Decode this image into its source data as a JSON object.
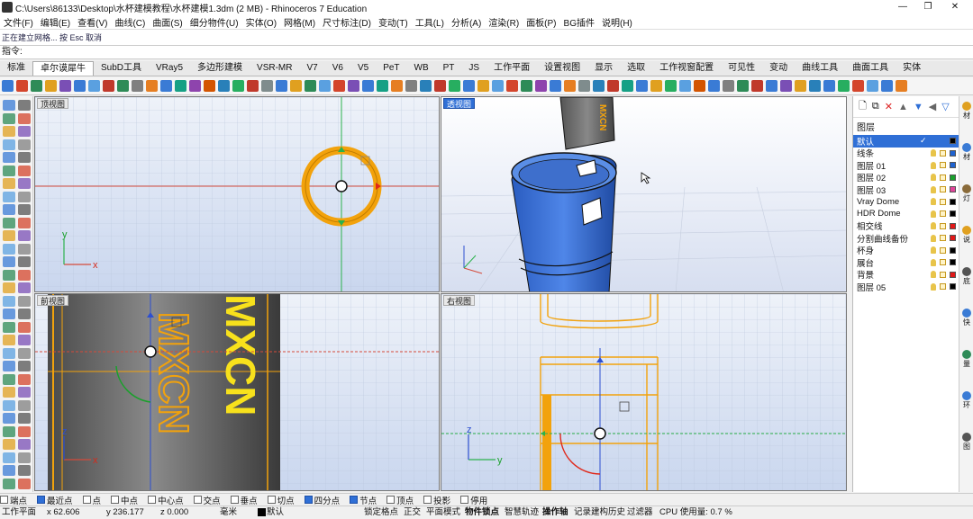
{
  "window": {
    "title": "C:\\Users\\86133\\Desktop\\水杯建模教程\\水杯建模1.3dm (2 MB) - Rhinoceros 7 Education",
    "controls": [
      "—",
      "❐",
      "✕"
    ]
  },
  "menu": [
    "文件(F)",
    "编辑(E)",
    "查看(V)",
    "曲线(C)",
    "曲面(S)",
    "细分物件(U)",
    "实体(O)",
    "网格(M)",
    "尺寸标注(D)",
    "变动(T)",
    "工具(L)",
    "分析(A)",
    "渲染(R)",
    "面板(P)",
    "BG插件",
    "说明(H)"
  ],
  "command": {
    "history": "正在建立网格... 按 Esc 取消",
    "prompt": "指令:"
  },
  "tabs": [
    "标准",
    "卓尔谟犀牛",
    "SubD工具",
    "VRay5",
    "多边形建模",
    "VSR-MR",
    "V7",
    "V6",
    "V5",
    "PeT",
    "WB",
    "PT",
    "JS",
    "工作平面",
    "设置视图",
    "显示",
    "选取",
    "工作视窗配置",
    "可见性",
    "变动",
    "曲线工具",
    "曲面工具",
    "实体"
  ],
  "active_tab_index": 1,
  "toolbar_colors": [
    "#3a7bd5",
    "#d4452c",
    "#2e8b57",
    "#e0a020",
    "#7a4fb5",
    "#3a7bd5",
    "#5aa0e0",
    "#c0392b",
    "#2e8b57",
    "#808080",
    "#e67e22",
    "#3a7bd5",
    "#16a085",
    "#8e44ad",
    "#d35400",
    "#2980b9",
    "#27ae60",
    "#c0392b",
    "#7f8c8d",
    "#3a7bd5",
    "#e0a020",
    "#2e8b57",
    "#5aa0e0",
    "#d4452c",
    "#7a4fb5",
    "#3a7bd5",
    "#16a085",
    "#e67e22",
    "#808080",
    "#2980b9",
    "#c0392b",
    "#27ae60",
    "#3a7bd5",
    "#e0a020",
    "#5aa0e0",
    "#d4452c",
    "#2e8b57",
    "#8e44ad",
    "#3a7bd5",
    "#e67e22",
    "#7f8c8d",
    "#2980b9",
    "#c0392b",
    "#16a085",
    "#3a7bd5",
    "#e0a020",
    "#27ae60",
    "#5aa0e0",
    "#d35400",
    "#3a7bd5",
    "#808080",
    "#2e8b57",
    "#c0392b",
    "#3a7bd5",
    "#7a4fb5",
    "#e0a020",
    "#2980b9",
    "#3a7bd5",
    "#27ae60",
    "#d4452c",
    "#5aa0e0",
    "#3a7bd5",
    "#e67e22"
  ],
  "viewports": {
    "top": {
      "label": "顶视图",
      "x_axis": "x",
      "y_axis": "y"
    },
    "perspective": {
      "label": "透视图"
    },
    "front": {
      "label": "前视图",
      "x_axis": "x",
      "z_axis": "z"
    },
    "right": {
      "label": "右视图",
      "y_axis": "y",
      "z_axis": "z"
    }
  },
  "model_text": {
    "cup_logo": "MXCN"
  },
  "layers_panel": {
    "title": "图层",
    "layers": [
      {
        "name": "默认",
        "color": "#000000",
        "current": true
      },
      {
        "name": "线条",
        "color": "#1e62d0"
      },
      {
        "name": "图层 01",
        "color": "#1e62d0"
      },
      {
        "name": "图层 02",
        "color": "#1aa02c"
      },
      {
        "name": "图层 03",
        "color": "#e0449a"
      },
      {
        "name": "Vray Dome",
        "color": "#000000"
      },
      {
        "name": "HDR Dome",
        "color": "#000000"
      },
      {
        "name": "相交线",
        "color": "#e01818"
      },
      {
        "name": "分割曲线备份",
        "color": "#e01818"
      },
      {
        "name": "杯身",
        "color": "#000000"
      },
      {
        "name": "展台",
        "color": "#000000"
      },
      {
        "name": "背景",
        "color": "#e01818"
      },
      {
        "name": "图层 05",
        "color": "#000000"
      }
    ]
  },
  "side_tabs": [
    "材",
    "材",
    "灯",
    "说",
    "底",
    "快",
    "量",
    "环",
    "图"
  ],
  "osnaps": [
    {
      "label": "端点",
      "on": false
    },
    {
      "label": "最近点",
      "on": true
    },
    {
      "label": "点",
      "on": false
    },
    {
      "label": "中点",
      "on": false
    },
    {
      "label": "中心点",
      "on": false
    },
    {
      "label": "交点",
      "on": false
    },
    {
      "label": "垂点",
      "on": false
    },
    {
      "label": "切点",
      "on": false
    },
    {
      "label": "四分点",
      "on": true
    },
    {
      "label": "节点",
      "on": true
    },
    {
      "label": "顶点",
      "on": false
    },
    {
      "label": "投影",
      "on": false
    },
    {
      "label": "停用",
      "on": false
    }
  ],
  "status": {
    "cplane": "工作平面",
    "x": "x 62.606",
    "y": "y 236.177",
    "z": "z 0.000",
    "units": "毫米",
    "layer": "默认",
    "grid_snap": "锁定格点",
    "ortho": "正交",
    "planar": "平面模式",
    "osnap": "物件锁点",
    "smarttrack": "智慧轨迹",
    "gumball": "操作轴",
    "history": "记录建构历史",
    "filter": "过滤器",
    "cpu": "CPU 使用量: 0.7 %"
  }
}
